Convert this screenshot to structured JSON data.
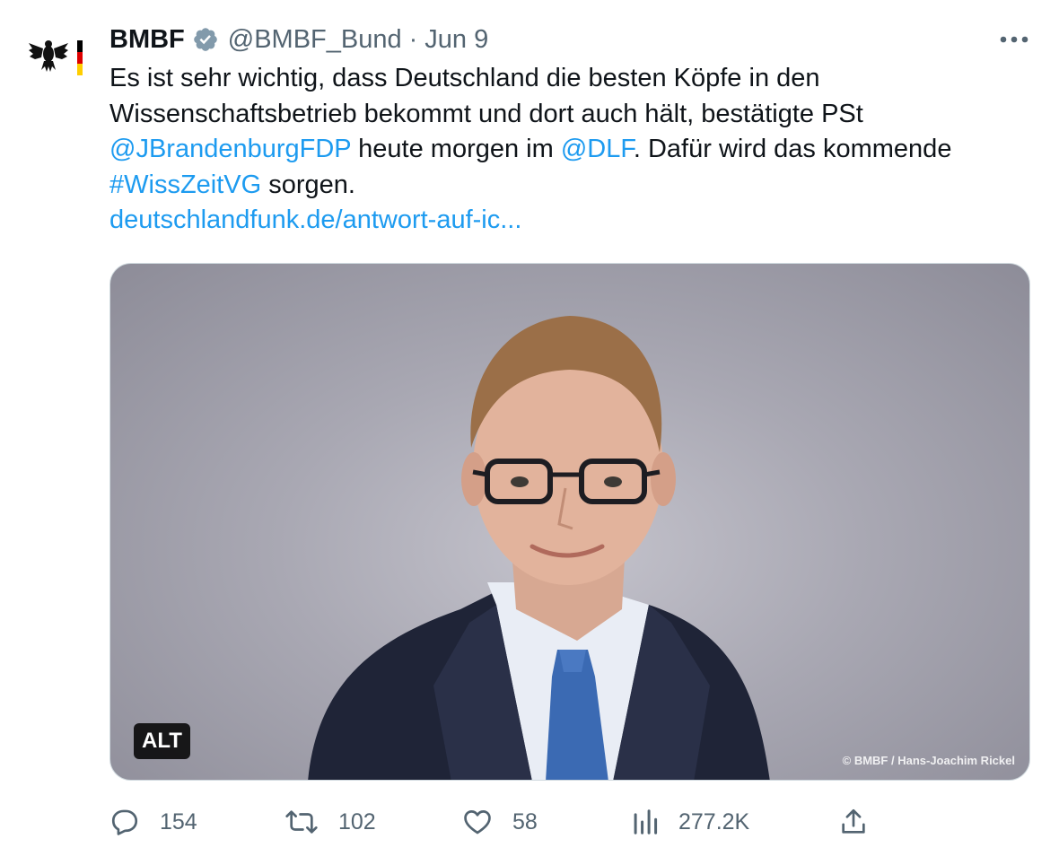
{
  "tweet": {
    "author": {
      "name": "BMBF",
      "handle": "@BMBF_Bund",
      "verified": true,
      "avatar_icon": "german-eagle-flag-icon"
    },
    "separator": "·",
    "date": "Jun 9",
    "more_icon": "more-horizontal-icon",
    "text": {
      "line1": "Es ist sehr wichtig, dass Deutschland die besten Köpfe in den",
      "line2": "Wissenschaftsbetrieb bekommt und dort auch hält, bestätigte PSt",
      "mention1": "@JBrandenburgFDP",
      "line3_mid": " heute morgen im ",
      "mention2": "@DLF",
      "line3_end": ". Dafür wird das kommende",
      "hashtag": "#WissZeitVG",
      "line4_end": " sorgen.",
      "url": "deutschlandfunk.de/antwort-auf-ic..."
    },
    "media": {
      "alt_badge": "ALT",
      "credit": "© BMBF / Hans-Joachim Rickel"
    },
    "actions": {
      "replies": "154",
      "retweets": "102",
      "likes": "58",
      "views": "277.2K"
    },
    "colors": {
      "link": "#1d9bf0",
      "muted": "#536471",
      "verified_badge": "#829aab"
    }
  }
}
